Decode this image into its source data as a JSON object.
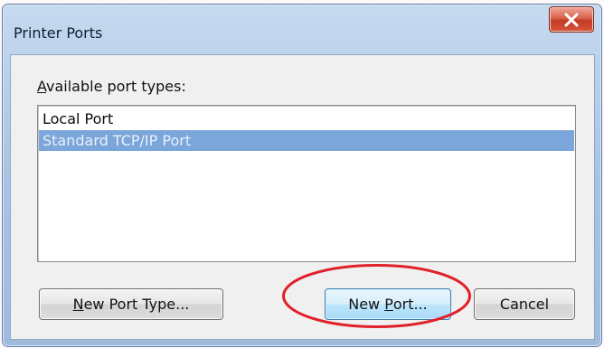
{
  "window": {
    "title": "Printer Ports",
    "close_glyph": "x"
  },
  "ports_label": {
    "access_key": "A",
    "rest": "vailable port types:"
  },
  "port_list": {
    "items": [
      {
        "label": "Local Port",
        "selected": false
      },
      {
        "label": "Standard TCP/IP Port",
        "selected": true
      }
    ]
  },
  "buttons": {
    "new_port_type": {
      "access_key": "N",
      "rest": "ew Port Type..."
    },
    "new_port": {
      "before": "New ",
      "access_key": "P",
      "after": "ort..."
    },
    "cancel": {
      "label": "Cancel"
    }
  },
  "colors": {
    "selection": "#7ba6d9",
    "annotation_ring": "#e0202a",
    "close_button": "#c43a24"
  },
  "icons": {
    "close": "close-icon"
  }
}
